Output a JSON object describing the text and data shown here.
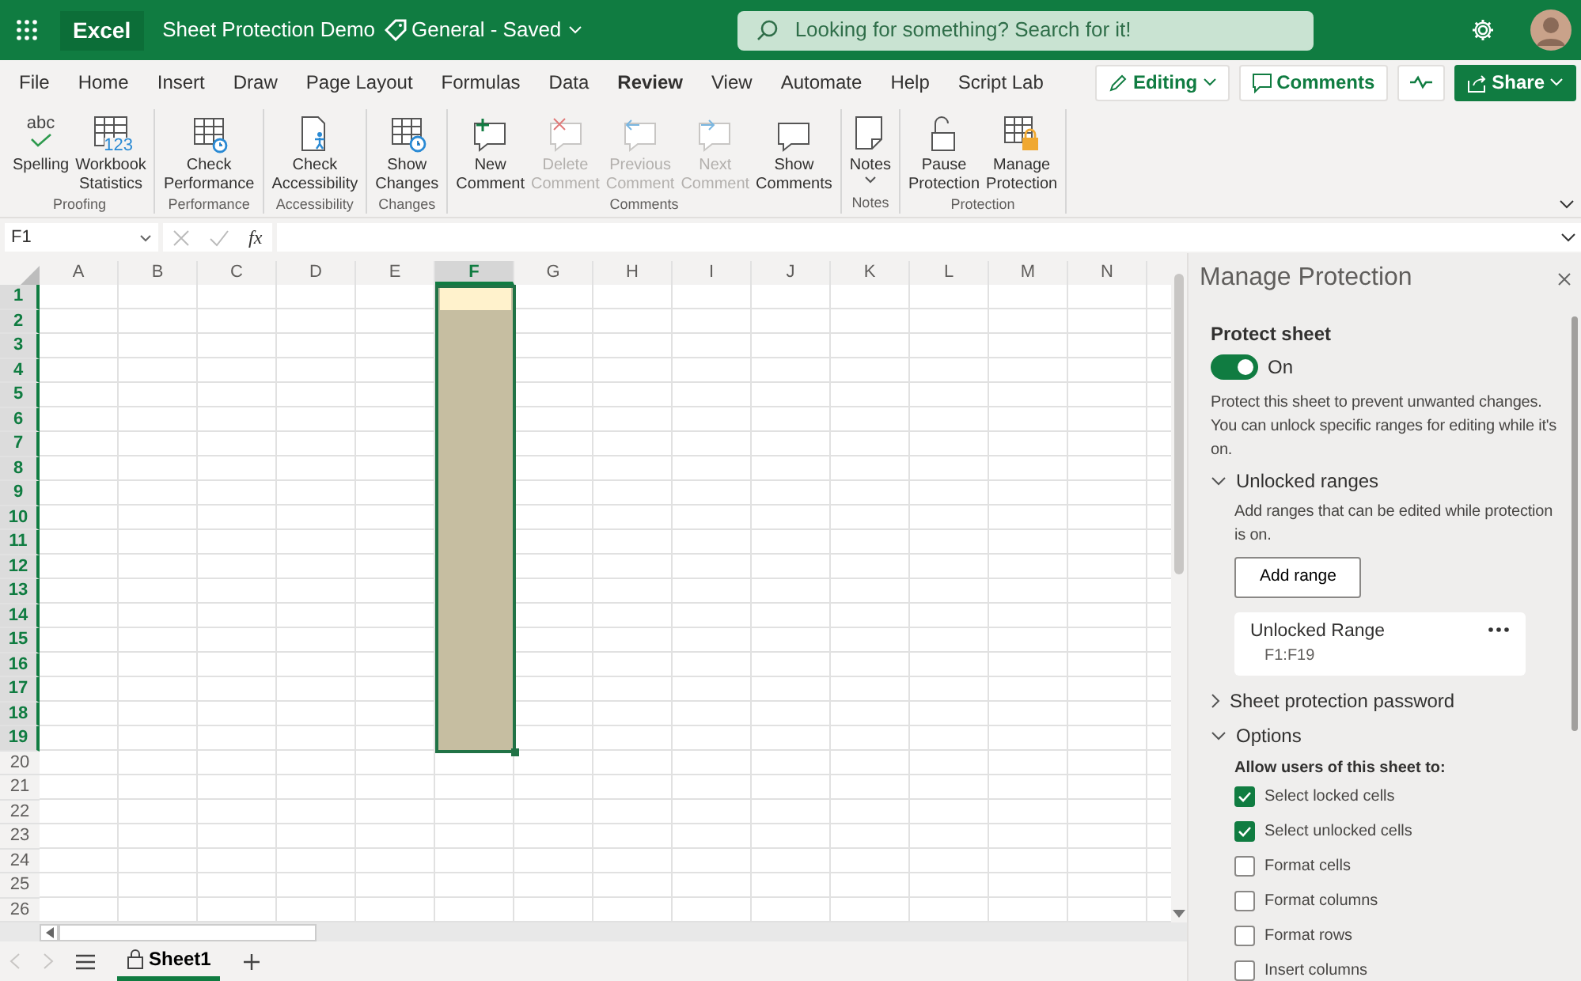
{
  "header": {
    "app_name": "Excel",
    "doc_title": "Sheet Protection Demo",
    "sensitivity": "General",
    "separator": "-",
    "save_status": "Saved",
    "search_placeholder": "Looking for something? Search for it!"
  },
  "menu_tabs": [
    {
      "label": "File",
      "selected": false
    },
    {
      "label": "Home",
      "selected": false
    },
    {
      "label": "Insert",
      "selected": false
    },
    {
      "label": "Draw",
      "selected": false
    },
    {
      "label": "Page Layout",
      "selected": false
    },
    {
      "label": "Formulas",
      "selected": false
    },
    {
      "label": "Data",
      "selected": false
    },
    {
      "label": "Review",
      "selected": true
    },
    {
      "label": "View",
      "selected": false
    },
    {
      "label": "Automate",
      "selected": false
    },
    {
      "label": "Help",
      "selected": false
    },
    {
      "label": "Script Lab",
      "selected": false
    }
  ],
  "actions": [
    {
      "kind": "editing",
      "label": "Editing"
    },
    {
      "kind": "comments",
      "label": "Comments"
    },
    {
      "kind": "activity"
    },
    {
      "kind": "share",
      "label": "Share"
    }
  ],
  "ribbon_groups": [
    {
      "label": "Proofing",
      "buttons": [
        {
          "label": "Spelling",
          "icon_text": "abc",
          "disabled": false
        },
        {
          "label": "Workbook Statistics",
          "icon_text": "123",
          "disabled": false
        }
      ]
    },
    {
      "label": "Performance",
      "buttons": [
        {
          "label": "Check Performance",
          "disabled": false
        }
      ]
    },
    {
      "label": "Accessibility",
      "buttons": [
        {
          "label": "Check Accessibility",
          "disabled": false
        }
      ]
    },
    {
      "label": "Changes",
      "buttons": [
        {
          "label": "Show Changes",
          "disabled": false
        }
      ]
    },
    {
      "label": "Comments",
      "buttons": [
        {
          "label": "New Comment",
          "disabled": false
        },
        {
          "label": "Delete Comment",
          "disabled": true
        },
        {
          "label": "Previous Comment",
          "disabled": true
        },
        {
          "label": "Next Comment",
          "disabled": true
        },
        {
          "label": "Show Comments",
          "disabled": false
        }
      ]
    },
    {
      "label": "Notes",
      "buttons": [
        {
          "label": "Notes",
          "disabled": false
        }
      ]
    },
    {
      "label": "Protection",
      "buttons": [
        {
          "label": "Pause Protection",
          "disabled": false
        },
        {
          "label": "Manage Protection",
          "disabled": false
        }
      ]
    }
  ],
  "formula_bar": {
    "name_box": "F1",
    "function_label": "fx"
  },
  "grid": {
    "columns": [
      {
        "label": "A",
        "selected": false
      },
      {
        "label": "B",
        "selected": false
      },
      {
        "label": "C",
        "selected": false
      },
      {
        "label": "D",
        "selected": false
      },
      {
        "label": "E",
        "selected": false
      },
      {
        "label": "F",
        "selected": true
      },
      {
        "label": "G",
        "selected": false
      },
      {
        "label": "H",
        "selected": false
      },
      {
        "label": "I",
        "selected": false
      },
      {
        "label": "J",
        "selected": false
      },
      {
        "label": "K",
        "selected": false
      },
      {
        "label": "L",
        "selected": false
      },
      {
        "label": "M",
        "selected": false
      },
      {
        "label": "N",
        "selected": false
      }
    ],
    "rows": [
      {
        "label": "1",
        "selected": true
      },
      {
        "label": "2",
        "selected": true
      },
      {
        "label": "3",
        "selected": true
      },
      {
        "label": "4",
        "selected": true
      },
      {
        "label": "5",
        "selected": true
      },
      {
        "label": "6",
        "selected": true
      },
      {
        "label": "7",
        "selected": true
      },
      {
        "label": "8",
        "selected": true
      },
      {
        "label": "9",
        "selected": true
      },
      {
        "label": "10",
        "selected": true
      },
      {
        "label": "11",
        "selected": true
      },
      {
        "label": "12",
        "selected": true
      },
      {
        "label": "13",
        "selected": true
      },
      {
        "label": "14",
        "selected": true
      },
      {
        "label": "15",
        "selected": true
      },
      {
        "label": "16",
        "selected": true
      },
      {
        "label": "17",
        "selected": true
      },
      {
        "label": "18",
        "selected": true
      },
      {
        "label": "19",
        "selected": true
      },
      {
        "label": "20",
        "selected": false
      },
      {
        "label": "21",
        "selected": false
      },
      {
        "label": "22",
        "selected": false
      },
      {
        "label": "23",
        "selected": false
      },
      {
        "label": "24",
        "selected": false
      },
      {
        "label": "25",
        "selected": false
      },
      {
        "label": "26",
        "selected": false
      }
    ]
  },
  "sheet_tabs": [
    {
      "name": "Sheet1",
      "selected": true,
      "locked": true
    }
  ],
  "panel": {
    "title": "Manage Protection",
    "protect_label": "Protect sheet",
    "protect_on": true,
    "toggle_text": "On",
    "description": "Protect this sheet to prevent unwanted changes. You can unlock specific ranges for editing while it's on.",
    "sections": [
      {
        "kind": "ranges",
        "title": "Unlocked ranges",
        "expanded": true,
        "text": "Add ranges that can be edited while protection is on.",
        "button": "Add range",
        "ranges": [
          {
            "name": "Unlocked Range",
            "address": "F1:F19"
          }
        ]
      },
      {
        "title": "Sheet protection password",
        "expanded": false
      },
      {
        "kind": "options",
        "title": "Options",
        "expanded": true,
        "heading": "Allow users of this sheet to:",
        "options": [
          {
            "label": "Select locked cells",
            "checked": true
          },
          {
            "label": "Select unlocked cells",
            "checked": true
          },
          {
            "label": "Format cells",
            "checked": false
          },
          {
            "label": "Format columns",
            "checked": false
          },
          {
            "label": "Format rows",
            "checked": false
          },
          {
            "label": "Insert columns",
            "checked": false
          }
        ]
      }
    ]
  }
}
